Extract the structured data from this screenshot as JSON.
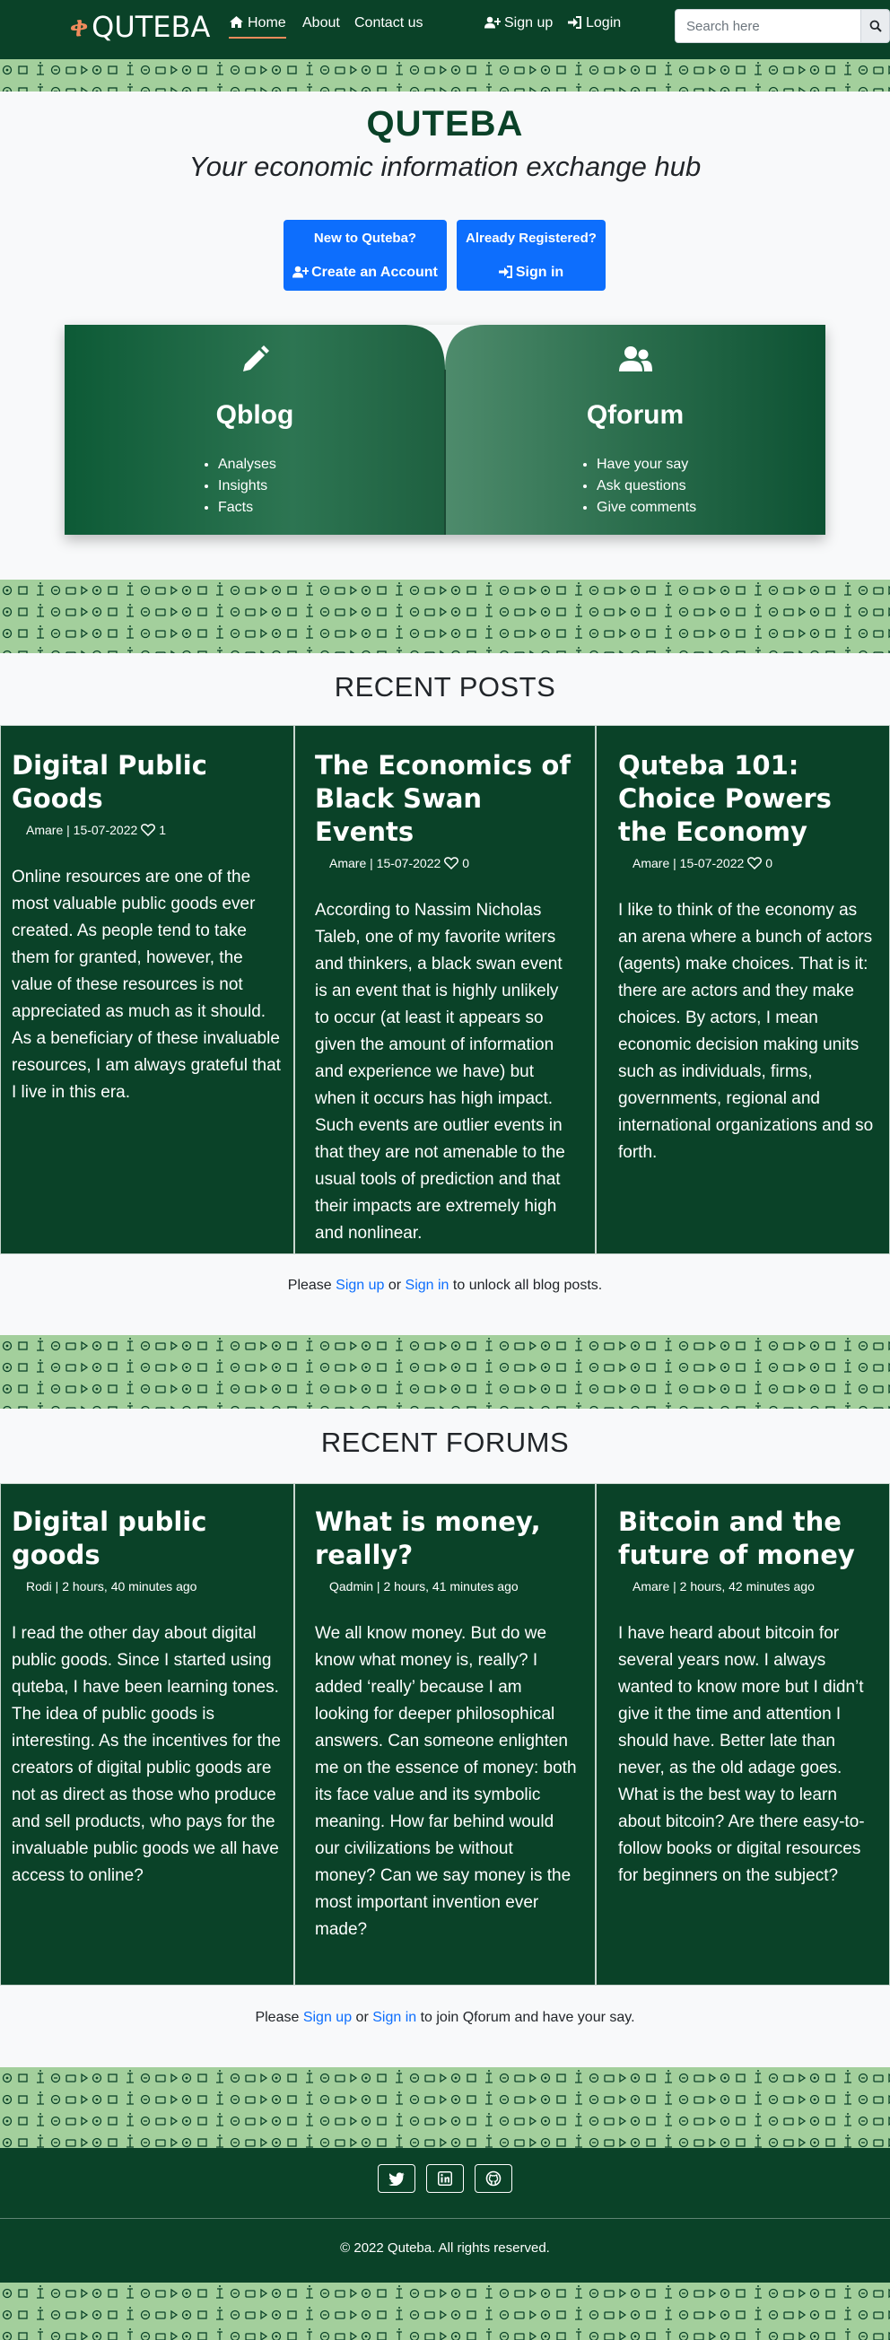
{
  "nav": {
    "brand": "QUTEBA",
    "logo_glyph": "ቀ",
    "links": [
      "Home",
      "About",
      "Contact us"
    ],
    "signup": "Sign up",
    "login": "Login",
    "search_placeholder": "Search here"
  },
  "hero": {
    "title": "QUTEBA",
    "subtitle": "Your economic information exchange hub",
    "cta_new": {
      "line1": "New to Quteba?",
      "line2": "Create an Account"
    },
    "cta_registered": {
      "line1": "Already Registered?",
      "line2": "Sign in"
    }
  },
  "book": {
    "left": {
      "title": "Qblog",
      "items": [
        "Analyses",
        "Insights",
        "Facts"
      ]
    },
    "right": {
      "title": "Qforum",
      "items": [
        "Have your say",
        "Ask questions",
        "Give comments"
      ]
    }
  },
  "recent_posts": {
    "heading": "RECENT POSTS",
    "posts": [
      {
        "title": "Digital Public Goods",
        "author": "Amare",
        "date": "15-07-2022",
        "likes": "1",
        "excerpt": "Online resources are one of the most valuable public goods ever created. As people tend to take them for granted, however, the value of these resources is not appreciated as much as it should. As a beneficiary of these invaluable resources, I am always grateful that I live in this era."
      },
      {
        "title": "The Economics of Black Swan Events",
        "author": "Amare",
        "date": "15-07-2022",
        "likes": "0",
        "excerpt": "According to Nassim Nicholas Taleb, one of my favorite writers and thinkers, a black swan event is an event that is highly unlikely to occur (at least it appears so given the amount of information and experience we have) but when it occurs has high impact. Such events are outlier events in that they are not amenable to the usual tools of prediction and that their impacts are extremely high and nonlinear."
      },
      {
        "title": "Quteba 101: Choice Powers the Economy",
        "author": "Amare",
        "date": "15-07-2022",
        "likes": "0",
        "excerpt": "I like to think of the economy as an arena where a bunch of actors (agents) make choices. That is it: there are actors and they make choices. By actors, I mean economic decision making units such as individuals, firms, governments, regional and international organizations and so forth."
      }
    ],
    "note": {
      "before": "Please ",
      "signup": "Sign up",
      "mid": " or ",
      "signin": "Sign in",
      "after": " to unlock all blog posts."
    }
  },
  "recent_forums": {
    "heading": "RECENT FORUMS",
    "forums": [
      {
        "title": "Digital public goods",
        "author": "Rodi",
        "time": "2 hours, 40 minutes ago",
        "excerpt": "I read the other day about digital public goods. Since I started using quteba, I have been learning tones. The idea of public goods is interesting. As the incentives for the creators of digital public goods are not as direct as those who produce and sell products, who pays for the invaluable public goods we all have access to online?"
      },
      {
        "title": "What is money, really?",
        "author": "Qadmin",
        "time": "2 hours, 41 minutes ago",
        "excerpt": "We all know money. But do we know what money is, really? I added ‘really’ because I am looking for deeper philosophical answers. Can someone enlighten me on the essence of money: both its face value and its symbolic meaning. How far behind would our civilizations be without money? Can we say money is the most important invention ever made?"
      },
      {
        "title": "Bitcoin and the future of money",
        "author": "Amare",
        "time": "2 hours, 42 minutes ago",
        "excerpt": "I have heard about bitcoin for several years now. I always wanted to know more but I didn’t give it the time and attention I should have. Better late than never, as the old adage goes. What is the best way to learn about bitcoin? Are there easy-to-follow books or digital resources for beginners on the subject?"
      }
    ],
    "note": {
      "before": "Please ",
      "signup": "Sign up",
      "mid": " or ",
      "signin": "Sign in",
      "after": " to join Qforum and have your say."
    }
  },
  "footer": {
    "social_icons": [
      "twitter-icon",
      "linkedin-icon",
      "github-icon"
    ],
    "copyright": "© 2022 Quteba. All rights reserved."
  },
  "colors": {
    "primary_green": "#0a4228",
    "pattern_green": "#a3cf9c",
    "accent_orange": "#f08b5c",
    "button_blue": "#0d6efd"
  }
}
